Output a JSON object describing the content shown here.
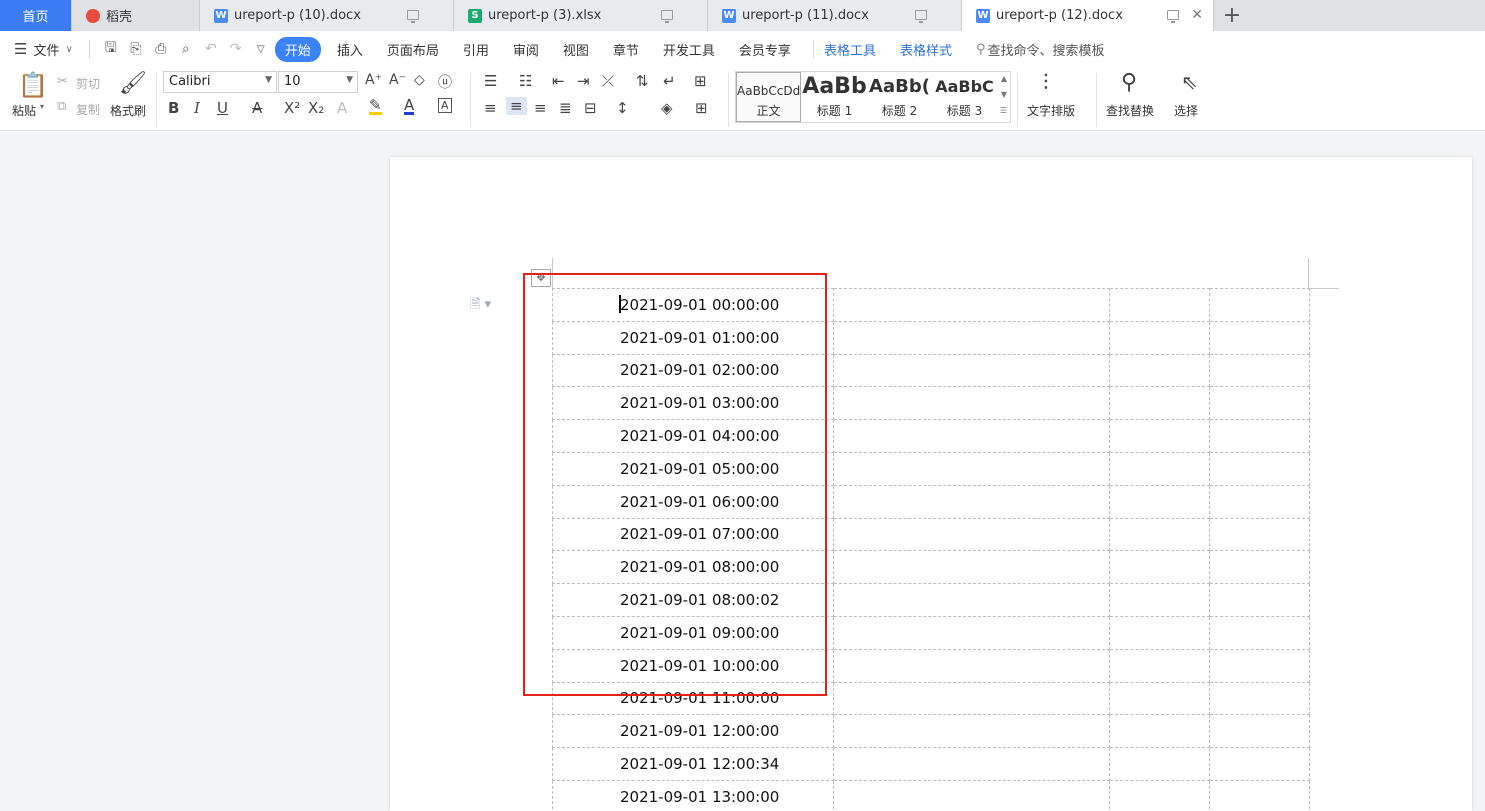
{
  "tabs": [
    {
      "label": "首页",
      "kind": "home"
    },
    {
      "label": "稻壳",
      "kind": "docer"
    },
    {
      "label": "ureport-p (10).docx",
      "kind": "w"
    },
    {
      "label": "ureport-p (3).xlsx",
      "kind": "s"
    },
    {
      "label": "ureport-p (11).docx",
      "kind": "w"
    },
    {
      "label": "ureport-p (12).docx",
      "kind": "w",
      "active": true
    }
  ],
  "menu": {
    "file": "文件",
    "items": [
      "插入",
      "页面布局",
      "引用",
      "审阅",
      "视图",
      "章节",
      "开发工具",
      "会员专享"
    ],
    "start": "开始",
    "table_tools": "表格工具",
    "table_style": "表格样式",
    "search_placeholder": "查找命令、搜索模板"
  },
  "ribbon": {
    "paste": "粘贴",
    "cut": "剪切",
    "copy": "复制",
    "format_painter": "格式刷",
    "font_name": "Calibri",
    "font_size": "10",
    "styles": [
      {
        "preview": "AaBbCcDd",
        "label": "正文"
      },
      {
        "preview": "AaBb",
        "label": "标题 1"
      },
      {
        "preview": "AaBb(",
        "label": "标题 2"
      },
      {
        "preview": "AaBbC",
        "label": "标题 3"
      }
    ],
    "text_layout": "文字排版",
    "find_replace": "查找替换",
    "select": "选择"
  },
  "table": {
    "rows": [
      "2021-09-01 00:00:00",
      "2021-09-01 01:00:00",
      "2021-09-01 02:00:00",
      "2021-09-01 03:00:00",
      "2021-09-01 04:00:00",
      "2021-09-01 05:00:00",
      "2021-09-01 06:00:00",
      "2021-09-01 07:00:00",
      "2021-09-01 08:00:00",
      "2021-09-01 08:00:02",
      "2021-09-01 09:00:00",
      "2021-09-01 10:00:00",
      "2021-09-01 11:00:00",
      "2021-09-01 12:00:00",
      "2021-09-01 12:00:34",
      "2021-09-01 13:00:00"
    ]
  },
  "colors": {
    "accent": "#3b82f6",
    "highlight_box": "#e2231a"
  }
}
